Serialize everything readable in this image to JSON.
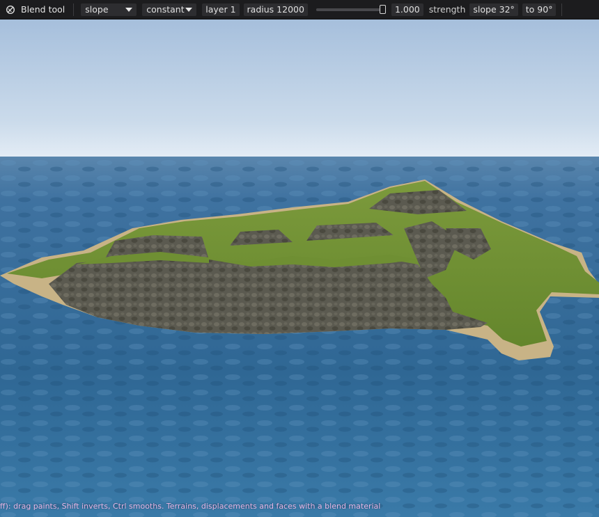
{
  "toolbar": {
    "tool_icon": "blend-icon",
    "tool_name": "Blend tool",
    "mode_select": "slope",
    "falloff_select": "constant",
    "layer": "layer 1",
    "radius": "radius 12000",
    "strength_slider_value": 1.0,
    "strength_value": "1.000",
    "strength_label": "strength",
    "slope_min": "slope 32°",
    "slope_max": "to 90°"
  },
  "status_bar": {
    "text": "ff): drag paints, Shift inverts, Ctrl smooths. Terrains, displacements and faces with a blend material"
  },
  "colors": {
    "toolbar_bg": "#1c1c1e",
    "sky_top": "#a9c1dd",
    "sky_horizon": "#dde9f4",
    "ocean": "#2e6591",
    "grass": "#6f8f33",
    "rock": "#5c5a4f",
    "sand": "#c9b486",
    "status_text": "#e6b8e8"
  }
}
